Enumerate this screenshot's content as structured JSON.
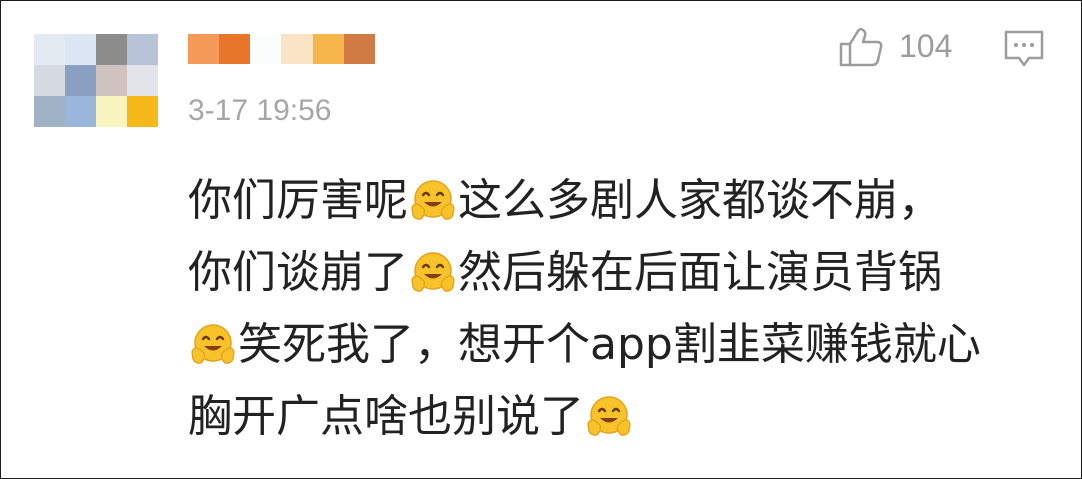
{
  "comment": {
    "avatar": {
      "pixel_colors": [
        "#e4eaf2",
        "#dce6f4",
        "#8d8d8d",
        "#b7c4d8",
        "#d6dbe2",
        "#8aa0c2",
        "#d0c3bf",
        "#e3e4ea",
        "#9fb2c6",
        "#9ab6da",
        "#faf5c0",
        "#f7b91a"
      ]
    },
    "username_blocks": [
      "#f69a5a",
      "#e7752a",
      "#fbfdfd",
      "#fbe4c6",
      "#f6b54a",
      "#d07a44"
    ],
    "timestamp": "3-17 19:56",
    "like_icon": "thumbs-up-icon",
    "like_count": "104",
    "reply_icon": "comment-bubble-icon",
    "text_lines": [
      [
        "你们厉害呢",
        "这么多剧人家都谈不崩，"
      ],
      [
        "你们谈崩了",
        "然后躲在后面让演员背锅"
      ],
      [
        "",
        "笑死我了，想开个app割韭菜赚钱就心"
      ],
      [
        "胸开广点啥也别说了",
        ""
      ]
    ],
    "emoji_name": "hugging-face-emoji",
    "colors": {
      "text": "#222222",
      "meta_gray": "#a6a6a6",
      "emoji_yellow": "#f8c22a"
    }
  }
}
